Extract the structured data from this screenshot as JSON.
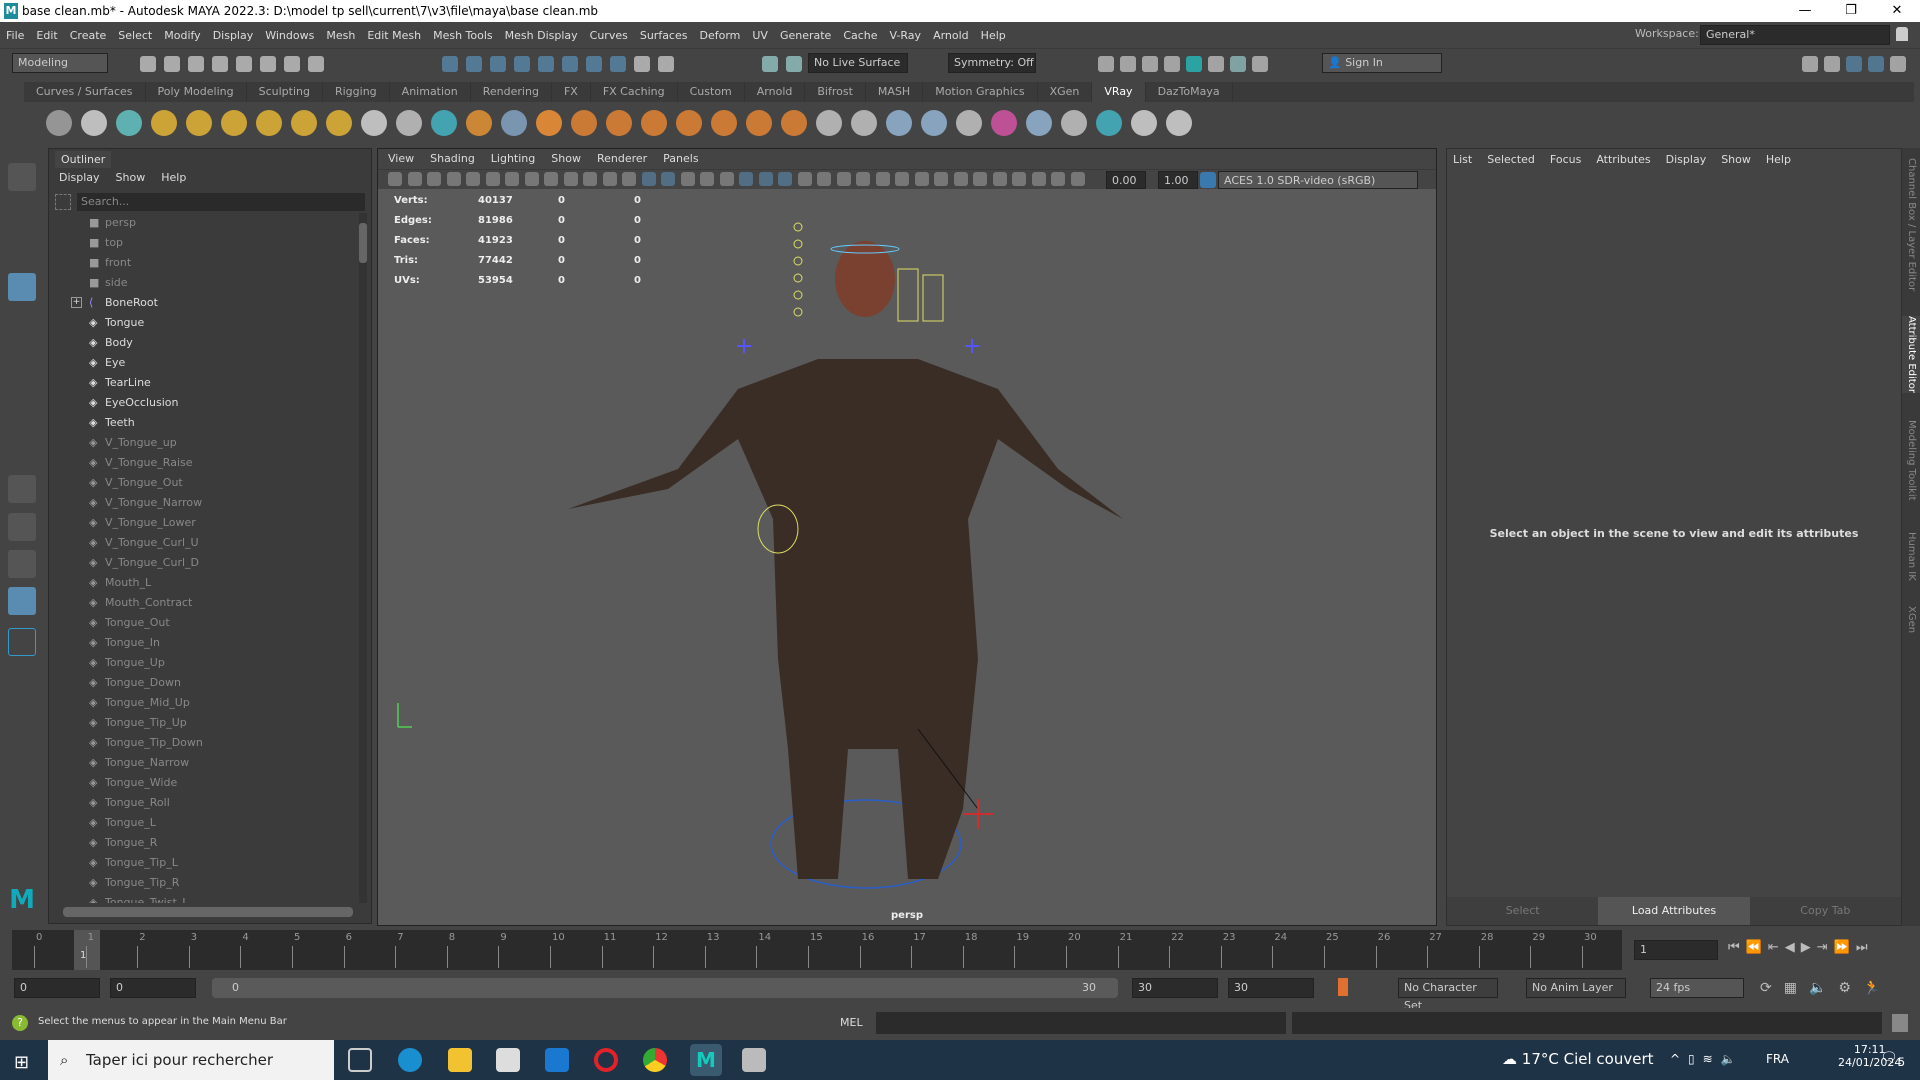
{
  "window": {
    "title": "base clean.mb* - Autodesk MAYA 2022.3: D:\\model tp sell\\current\\7\\v3\\file\\maya\\base clean.mb",
    "logo": "M",
    "minimize": "—",
    "restore": "❐",
    "close": "✕"
  },
  "menubar": [
    "File",
    "Edit",
    "Create",
    "Select",
    "Modify",
    "Display",
    "Windows",
    "Mesh",
    "Edit Mesh",
    "Mesh Tools",
    "Mesh Display",
    "Curves",
    "Surfaces",
    "Deform",
    "UV",
    "Generate",
    "Cache",
    "V-Ray",
    "Arnold",
    "Help"
  ],
  "workspace": {
    "label": "Workspace:",
    "value": "General*"
  },
  "statusline": {
    "mode": "Modeling",
    "live_surface": "No Live Surface",
    "symmetry": "Symmetry: Off",
    "sign_in": "Sign In"
  },
  "shelf_tabs": [
    "Curves / Surfaces",
    "Poly Modeling",
    "Sculpting",
    "Rigging",
    "Animation",
    "Rendering",
    "FX",
    "FX Caching",
    "Custom",
    "Arnold",
    "Bifrost",
    "MASH",
    "Motion Graphics",
    "XGen",
    "VRay",
    "DazToMaya"
  ],
  "shelf_active": "VRay",
  "outliner": {
    "tab": "Outliner",
    "menu": [
      "Display",
      "Show",
      "Help"
    ],
    "search_placeholder": "Search...",
    "items": [
      {
        "name": "persp",
        "type": "camera",
        "dim": true
      },
      {
        "name": "top",
        "type": "camera",
        "dim": true
      },
      {
        "name": "front",
        "type": "camera",
        "dim": true
      },
      {
        "name": "side",
        "type": "camera",
        "dim": true
      },
      {
        "name": "BoneRoot",
        "type": "joint",
        "dim": false,
        "expandable": true
      },
      {
        "name": "Tongue",
        "type": "mesh",
        "dim": false
      },
      {
        "name": "Body",
        "type": "mesh",
        "dim": false
      },
      {
        "name": "Eye",
        "type": "mesh",
        "dim": false
      },
      {
        "name": "TearLine",
        "type": "mesh",
        "dim": false
      },
      {
        "name": "EyeOcclusion",
        "type": "mesh",
        "dim": false
      },
      {
        "name": "Teeth",
        "type": "mesh",
        "dim": false
      },
      {
        "name": "V_Tongue_up",
        "type": "mesh",
        "dim": true
      },
      {
        "name": "V_Tongue_Raise",
        "type": "mesh",
        "dim": true
      },
      {
        "name": "V_Tongue_Out",
        "type": "mesh",
        "dim": true
      },
      {
        "name": "V_Tongue_Narrow",
        "type": "mesh",
        "dim": true
      },
      {
        "name": "V_Tongue_Lower",
        "type": "mesh",
        "dim": true
      },
      {
        "name": "V_Tongue_Curl_U",
        "type": "mesh",
        "dim": true
      },
      {
        "name": "V_Tongue_Curl_D",
        "type": "mesh",
        "dim": true
      },
      {
        "name": "Mouth_L",
        "type": "mesh",
        "dim": true
      },
      {
        "name": "Mouth_Contract",
        "type": "mesh",
        "dim": true
      },
      {
        "name": "Tongue_Out",
        "type": "mesh",
        "dim": true
      },
      {
        "name": "Tongue_In",
        "type": "mesh",
        "dim": true
      },
      {
        "name": "Tongue_Up",
        "type": "mesh",
        "dim": true
      },
      {
        "name": "Tongue_Down",
        "type": "mesh",
        "dim": true
      },
      {
        "name": "Tongue_Mid_Up",
        "type": "mesh",
        "dim": true
      },
      {
        "name": "Tongue_Tip_Up",
        "type": "mesh",
        "dim": true
      },
      {
        "name": "Tongue_Tip_Down",
        "type": "mesh",
        "dim": true
      },
      {
        "name": "Tongue_Narrow",
        "type": "mesh",
        "dim": true
      },
      {
        "name": "Tongue_Wide",
        "type": "mesh",
        "dim": true
      },
      {
        "name": "Tongue_Roll",
        "type": "mesh",
        "dim": true
      },
      {
        "name": "Tongue_L",
        "type": "mesh",
        "dim": true
      },
      {
        "name": "Tongue_R",
        "type": "mesh",
        "dim": true
      },
      {
        "name": "Tongue_Tip_L",
        "type": "mesh",
        "dim": true
      },
      {
        "name": "Tongue_Tip_R",
        "type": "mesh",
        "dim": true
      },
      {
        "name": "Tongue_Twist_L",
        "type": "mesh",
        "dim": true
      }
    ]
  },
  "viewport": {
    "menu": [
      "View",
      "Shading",
      "Lighting",
      "Show",
      "Renderer",
      "Panels"
    ],
    "exposure": "0.00",
    "gamma": "1.00",
    "color_space": "ACES 1.0 SDR-video (sRGB)",
    "camera_label": "persp",
    "stats": [
      {
        "label": "Verts:",
        "v": [
          "40137",
          "0",
          "0"
        ]
      },
      {
        "label": "Edges:",
        "v": [
          "81986",
          "0",
          "0"
        ]
      },
      {
        "label": "Faces:",
        "v": [
          "41923",
          "0",
          "0"
        ]
      },
      {
        "label": "Tris:",
        "v": [
          "77442",
          "0",
          "0"
        ]
      },
      {
        "label": "UVs:",
        "v": [
          "53954",
          "0",
          "0"
        ]
      }
    ]
  },
  "attribute_editor": {
    "menu": [
      "List",
      "Selected",
      "Focus",
      "Attributes",
      "Display",
      "Show",
      "Help"
    ],
    "message": "Select an object in the scene to view and edit its attributes",
    "buttons": [
      "Select",
      "Load Attributes",
      "Copy Tab"
    ]
  },
  "side_tabs": [
    "Channel Box / Layer Editor",
    "Attribute Editor",
    "Modeling Toolkit",
    "Human IK",
    "XGen"
  ],
  "timeline": {
    "ticks": [
      "0",
      "1",
      "2",
      "3",
      "4",
      "5",
      "6",
      "7",
      "8",
      "9",
      "10",
      "11",
      "12",
      "13",
      "14",
      "15",
      "16",
      "17",
      "18",
      "19",
      "20",
      "21",
      "22",
      "23",
      "24",
      "25",
      "26",
      "27",
      "28",
      "29",
      "30"
    ],
    "current_frame": "1",
    "current_frame_field": "1"
  },
  "range": {
    "start": "0",
    "anim_start": "0",
    "slider_start": "0",
    "slider_end": "30",
    "anim_end": "30",
    "end": "30",
    "character_set": "No Character Set",
    "anim_layer": "No Anim Layer",
    "fps": "24 fps"
  },
  "commandline": {
    "help_text": "Select the menus to appear in the Main Menu Bar",
    "language": "MEL"
  },
  "taskbar": {
    "search_placeholder": "Taper ici pour rechercher",
    "weather": "17°C  Ciel couvert",
    "lang": "FRA",
    "time": "17:11",
    "date": "24/01/2024",
    "notifications": "5"
  }
}
